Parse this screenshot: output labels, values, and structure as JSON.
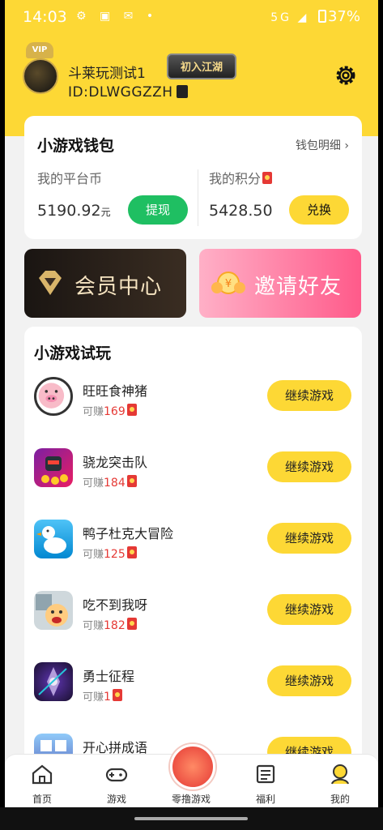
{
  "status_bar": {
    "time": "14:03",
    "battery": "37%",
    "network": "5G"
  },
  "profile": {
    "username": "斗莱玩测试1",
    "user_id": "ID:DLWGGZZH",
    "vip_badge": "VIP",
    "rank_badge": "初入江湖"
  },
  "wallet": {
    "title": "小游戏钱包",
    "detail_link": "钱包明细 ›",
    "platform_coin_label": "我的平台币",
    "platform_coin_value": "5190.92",
    "platform_coin_unit": "元",
    "withdraw_label": "提现",
    "points_label": "我的积分",
    "points_value": "5428.50",
    "exchange_label": "兑换"
  },
  "banners": {
    "vip_center": "会员中心",
    "invite": "邀请好友"
  },
  "games": {
    "title": "小游戏试玩",
    "earn_prefix": "可赚",
    "play_label": "继续游戏",
    "items": [
      {
        "name": "旺旺食神猪",
        "earn": "169"
      },
      {
        "name": "骁龙突击队",
        "earn": "184"
      },
      {
        "name": "鸭子杜克大冒险",
        "earn": "125"
      },
      {
        "name": "吃不到我呀",
        "earn": "182"
      },
      {
        "name": "勇士征程",
        "earn": "1"
      },
      {
        "name": "开心拼成语",
        "earn": ""
      }
    ]
  },
  "tabbar": {
    "home": "首页",
    "games": "游戏",
    "center": "零撸游戏",
    "welfare": "福利",
    "mine": "我的"
  },
  "colors": {
    "brand_yellow": "#fdd835",
    "withdraw_green": "#1fbf62",
    "red_accent": "#e53935"
  }
}
